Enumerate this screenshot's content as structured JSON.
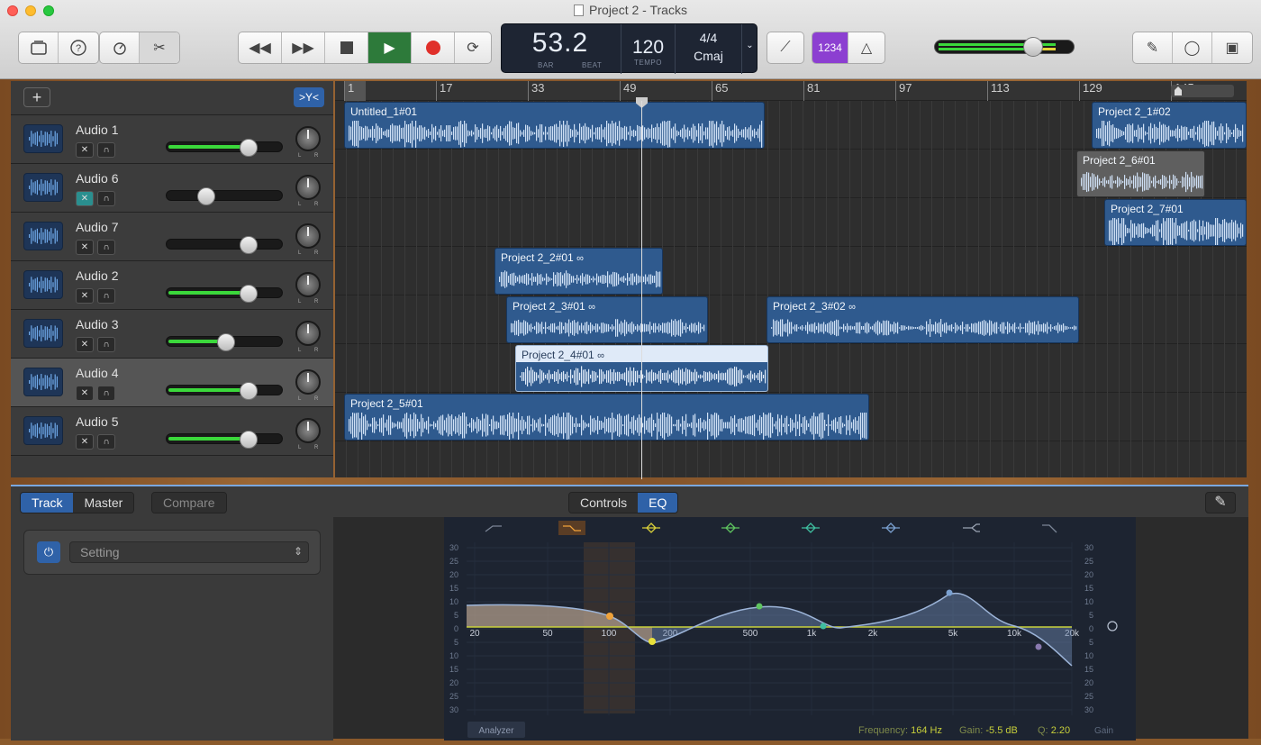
{
  "window": {
    "title": "Project 2 - Tracks"
  },
  "toolbar": {
    "library": "library-icon",
    "help": "?",
    "smart_controls": "smart-controls-icon",
    "editors": "scissors-icon",
    "lcd": {
      "bar_beat": "53.2",
      "bar_label": "BAR",
      "beat_label": "BEAT",
      "tempo": "120",
      "tempo_label": "TEMPO",
      "signature": "4/4",
      "key": "Cmaj"
    },
    "count_in": "1234"
  },
  "ruler": {
    "marks": [
      "1",
      "17",
      "33",
      "49",
      "65",
      "81",
      "97",
      "113",
      "129",
      "145"
    ]
  },
  "tracks": [
    {
      "name": "Audio 1",
      "volume": 0.72
    },
    {
      "name": "Audio 6",
      "volume": 0.35
    },
    {
      "name": "Audio 7",
      "volume": 0.72
    },
    {
      "name": "Audio 2",
      "volume": 0.72
    },
    {
      "name": "Audio 3",
      "volume": 0.52
    },
    {
      "name": "Audio 4",
      "volume": 0.72
    },
    {
      "name": "Audio 5",
      "volume": 0.72
    }
  ],
  "pan_labels": {
    "l": "L",
    "r": "R"
  },
  "regions": [
    {
      "name": "Untitled_1#01"
    },
    {
      "name": "Project 2_1#02"
    },
    {
      "name": "Project 2_6#01"
    },
    {
      "name": "Project 2_7#01"
    },
    {
      "name": "Project 2_2#01"
    },
    {
      "name": "Project 2_3#01"
    },
    {
      "name": "Project 2_3#02"
    },
    {
      "name": "Project 2_4#01"
    },
    {
      "name": "Project 2_5#01"
    }
  ],
  "editor": {
    "tab_track": "Track",
    "tab_master": "Master",
    "compare": "Compare",
    "tab_controls": "Controls",
    "tab_eq": "EQ",
    "setting_placeholder": "Setting",
    "eq": {
      "db_labels": [
        "30",
        "25",
        "20",
        "15",
        "10",
        "5",
        "0",
        "5",
        "10",
        "15",
        "20",
        "25",
        "30"
      ],
      "freq_labels": [
        "20",
        "50",
        "100",
        "200",
        "500",
        "1k",
        "2k",
        "5k",
        "10k",
        "20k"
      ],
      "analyzer": "Analyzer",
      "frequency_label": "Frequency:",
      "frequency_value": "164 Hz",
      "gain_label": "Gain:",
      "gain_value": "-5.5 dB",
      "q_label": "Q:",
      "q_value": "2.20",
      "gain_axis": "Gain"
    }
  },
  "colors": {
    "accent": "#2f62a8",
    "region": "#2f5a8e",
    "meter": "#3bd83b",
    "record": "#e0302a",
    "play": "#2d7a3a",
    "count_in": "#8c3fd1"
  }
}
